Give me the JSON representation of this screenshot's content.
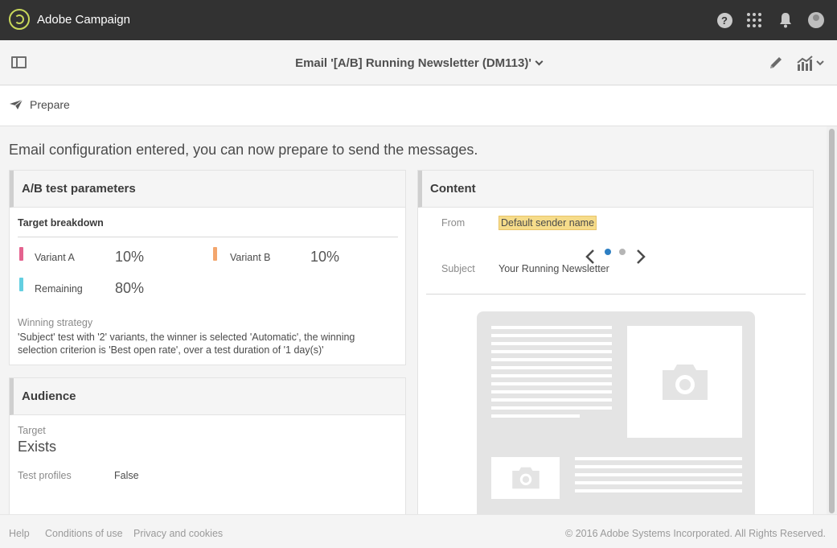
{
  "app": {
    "name": "Adobe Campaign"
  },
  "header": {
    "title": "Email '[A/B] Running Newsletter (DM113)'"
  },
  "actions": {
    "prepare_label": "Prepare"
  },
  "intro": "Email configuration entered, you can now prepare to send the messages.",
  "ab_test": {
    "title": "A/B test parameters",
    "breakdown_title": "Target breakdown",
    "variants": [
      {
        "label": "Variant A",
        "percent": "10%",
        "color": "#e4638f"
      },
      {
        "label": "Variant B",
        "percent": "10%",
        "color": "#f3a66d"
      },
      {
        "label": "Remaining",
        "percent": "80%",
        "color": "#63cfe1"
      }
    ],
    "strategy_label": "Winning strategy",
    "strategy_text": "'Subject' test with '2' variants, the winner is selected 'Automatic', the winning selection criterion is 'Best open rate', over a test duration of '1 day(s)'"
  },
  "audience": {
    "title": "Audience",
    "target_label": "Target",
    "target_value": "Exists",
    "test_profiles_label": "Test profiles",
    "test_profiles_value": "False"
  },
  "content": {
    "title": "Content",
    "from_label": "From",
    "from_value": "Default sender name",
    "subject_label": "Subject",
    "subject_value": "Your Running Newsletter",
    "carousel": {
      "total": 2,
      "active": 1
    }
  },
  "footer": {
    "links": [
      "Help",
      "Conditions of use",
      "Privacy and cookies"
    ],
    "copyright": "© 2016 Adobe Systems Incorporated. All Rights Reserved."
  },
  "colors": {
    "topbar": "#323232",
    "accent": "#2d7fc3",
    "highlight": "#f6dc8a"
  },
  "icons": [
    "adobe-campaign-logo-icon",
    "help-icon",
    "apps-grid-icon",
    "bell-icon",
    "avatar-icon",
    "panel-toggle-icon",
    "chevron-down-icon",
    "pencil-icon",
    "report-chart-icon",
    "paper-plane-icon",
    "chevron-left-icon",
    "chevron-right-icon",
    "camera-icon"
  ]
}
